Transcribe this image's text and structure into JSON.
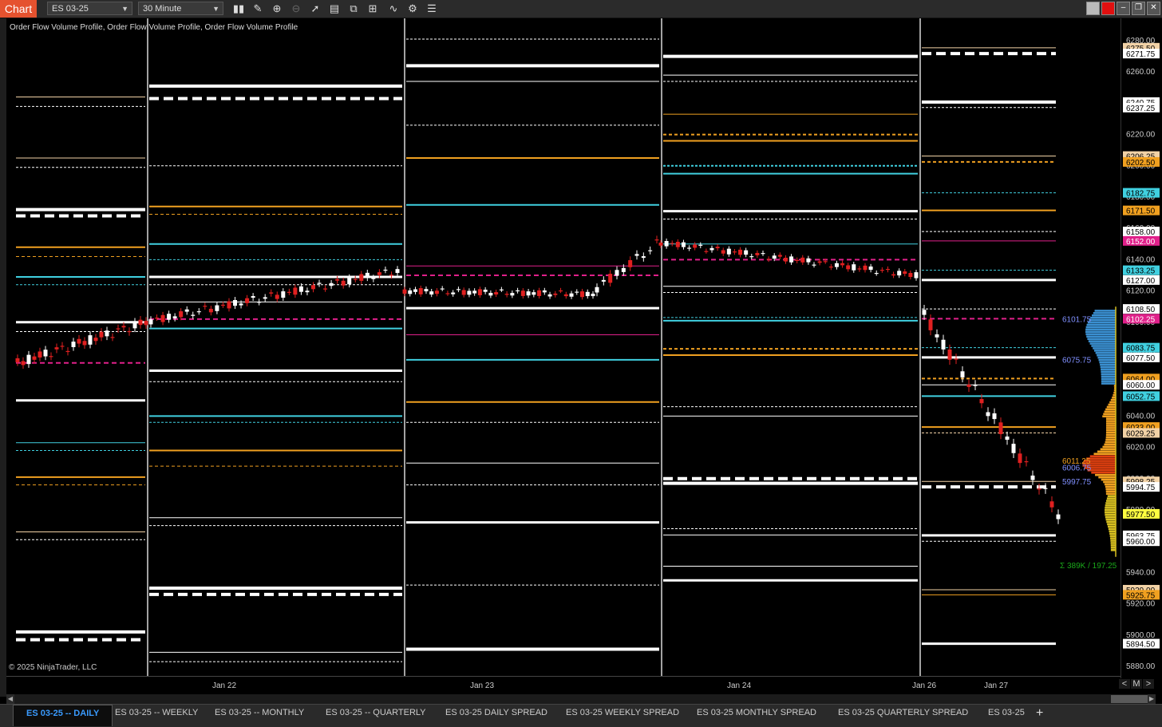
{
  "toolbar": {
    "chart_label": "Chart",
    "instrument": "ES 03-25",
    "interval": "30 Minute"
  },
  "chart": {
    "indicator_title": "Order Flow Volume Profile, Order Flow Volume Profile, Order Flow Volume Profile",
    "copyright": "© 2025 NinjaTrader, LLC",
    "volume_info": "Σ 389K / 197.25"
  },
  "colors": {
    "background": "#000000",
    "up_candle": "#ffffff",
    "down_candle": "#e02020",
    "white_level": "#ffffff",
    "orange_level": "#f0a020",
    "cyan_level": "#40d0e0",
    "magenta_level": "#e0208a",
    "brand": "#e5522f",
    "active_tab": "#3a9bff"
  },
  "zoom": {
    "minus": "<",
    "mode": "M",
    "plus": ">"
  },
  "tabs": [
    {
      "label": "ES 03-25 -- DAILY",
      "active": true
    },
    {
      "label": "ES 03-25 -- WEEKLY"
    },
    {
      "label": "ES 03-25 -- MONTHLY"
    },
    {
      "label": "ES 03-25 -- QUARTERLY"
    },
    {
      "label": "ES 03-25 DAILY SPREAD"
    },
    {
      "label": "ES 03-25 WEEKLY SPREAD"
    },
    {
      "label": "ES 03-25 MONTHLY SPREAD"
    },
    {
      "label": "ES 03-25 QUARTERLY SPREAD"
    },
    {
      "label": "ES 03-25"
    }
  ],
  "chart_data": {
    "type": "candlestick",
    "x_ticks": [
      "Jan 22",
      "Jan 23",
      "Jan 24",
      "Jan 26",
      "Jan 27"
    ],
    "y_range": [
      5875,
      6283
    ],
    "y_ticks": [
      "6280.00",
      "6260.00",
      "6240.00",
      "6220.00",
      "6200.00",
      "6180.00",
      "6160.00",
      "6140.00",
      "6120.00",
      "6100.00",
      "6080.00",
      "6060.00",
      "6040.00",
      "6020.00",
      "6000.00",
      "5980.00",
      "5960.00",
      "5940.00",
      "5920.00",
      "5900.00",
      "5880.00"
    ],
    "price_badges": [
      {
        "label": "6275.50",
        "price": 6275.5,
        "bg": "#f2d2a6",
        "fg": "#000000"
      },
      {
        "label": "6271.75",
        "price": 6271.75,
        "bg": "#ffffff",
        "fg": "#000000"
      },
      {
        "label": "6240.75",
        "price": 6240.75,
        "bg": "#ffffff",
        "fg": "#000000"
      },
      {
        "label": "6237.25",
        "price": 6237.25,
        "bg": "#ffffff",
        "fg": "#000000"
      },
      {
        "label": "6206.25",
        "price": 6206.25,
        "bg": "#f2d2a6",
        "fg": "#000000"
      },
      {
        "label": "6202.50",
        "price": 6202.5,
        "bg": "#f0a020",
        "fg": "#000000"
      },
      {
        "label": "6182.75",
        "price": 6182.75,
        "bg": "#40d0e0",
        "fg": "#000000"
      },
      {
        "label": "6171.50",
        "price": 6171.5,
        "bg": "#f0a020",
        "fg": "#000000"
      },
      {
        "label": "6158.00",
        "price": 6158,
        "bg": "#ffffff",
        "fg": "#000000"
      },
      {
        "label": "6152.00",
        "price": 6152,
        "bg": "#e0208a",
        "fg": "#ffffff"
      },
      {
        "label": "6133.25",
        "price": 6133.25,
        "bg": "#40d0e0",
        "fg": "#000000"
      },
      {
        "label": "6127.00",
        "price": 6127,
        "bg": "#ffffff",
        "fg": "#000000"
      },
      {
        "label": "6108.50",
        "price": 6108.5,
        "bg": "#ffffff",
        "fg": "#000000"
      },
      {
        "label": "6102.25",
        "price": 6102.25,
        "bg": "#e0208a",
        "fg": "#ffffff"
      },
      {
        "label": "6083.75",
        "price": 6083.75,
        "bg": "#40d0e0",
        "fg": "#000000"
      },
      {
        "label": "6077.50",
        "price": 6077.5,
        "bg": "#ffffff",
        "fg": "#000000"
      },
      {
        "label": "6064.00",
        "price": 6064,
        "bg": "#f0a020",
        "fg": "#000000"
      },
      {
        "label": "6060.00",
        "price": 6060,
        "bg": "#ffffff",
        "fg": "#000000"
      },
      {
        "label": "6052.75",
        "price": 6052.75,
        "bg": "#40d0e0",
        "fg": "#000000"
      },
      {
        "label": "6033.00",
        "price": 6033,
        "bg": "#f0a020",
        "fg": "#000000"
      },
      {
        "label": "6029.25",
        "price": 6029.25,
        "bg": "#f2d2a6",
        "fg": "#000000"
      },
      {
        "label": "5998.25",
        "price": 5998.25,
        "bg": "#f2d2a6",
        "fg": "#000000"
      },
      {
        "label": "5994.75",
        "price": 5994.75,
        "bg": "#ffffff",
        "fg": "#000000"
      },
      {
        "label": "5977.50",
        "price": 5977.5,
        "bg": "#ffff40",
        "fg": "#000000"
      },
      {
        "label": "5963.75",
        "price": 5963.75,
        "bg": "#ffffff",
        "fg": "#000000"
      },
      {
        "label": "5960.00",
        "price": 5960,
        "bg": "#ffffff",
        "fg": "#000000"
      },
      {
        "label": "5929.00",
        "price": 5929,
        "bg": "#f2d2a6",
        "fg": "#000000"
      },
      {
        "label": "5925.75",
        "price": 5925.75,
        "bg": "#f0a020",
        "fg": "#000000"
      },
      {
        "label": "5894.50",
        "price": 5894.5,
        "bg": "#ffffff",
        "fg": "#000000"
      }
    ],
    "profile_labels": [
      {
        "label": "6101.75",
        "price": 6101.75,
        "color": "#8090ff"
      },
      {
        "label": "6075.75",
        "price": 6075.75,
        "color": "#8090ff"
      },
      {
        "label": "6011.25",
        "price": 6011.25,
        "color": "#f0a020"
      },
      {
        "label": "6006.75",
        "price": 6006.75,
        "color": "#8090ff"
      },
      {
        "label": "5997.75",
        "price": 5997.75,
        "color": "#8090ff"
      }
    ]
  }
}
